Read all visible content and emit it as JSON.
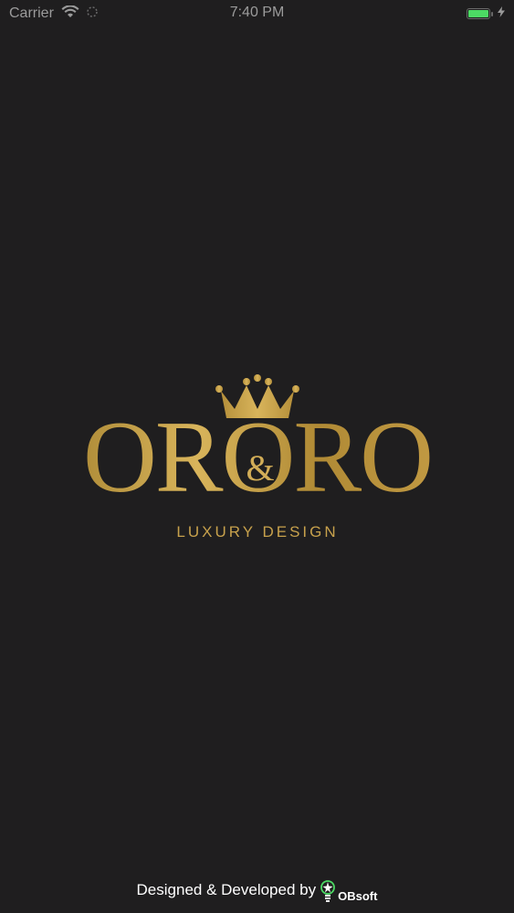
{
  "status_bar": {
    "carrier": "Carrier",
    "time": "7:40 PM",
    "battery_level": 1.0
  },
  "logo": {
    "brand": "ORORO",
    "ampersand": "&",
    "tagline": "LUXURY DESIGN"
  },
  "footer": {
    "credit": "Designed & Developed by",
    "company": "OBsoft"
  },
  "colors": {
    "background": "#1f1e1f",
    "gold": "#c7a14c",
    "battery_green": "#4cd964",
    "obsoft_green": "#4cd964"
  },
  "icons": {
    "wifi": "wifi-icon",
    "signal": "signal-icon",
    "battery": "battery-icon",
    "charging": "charging-icon",
    "crown": "crown-icon",
    "obsoft_logo": "obsoft-logo-icon"
  }
}
